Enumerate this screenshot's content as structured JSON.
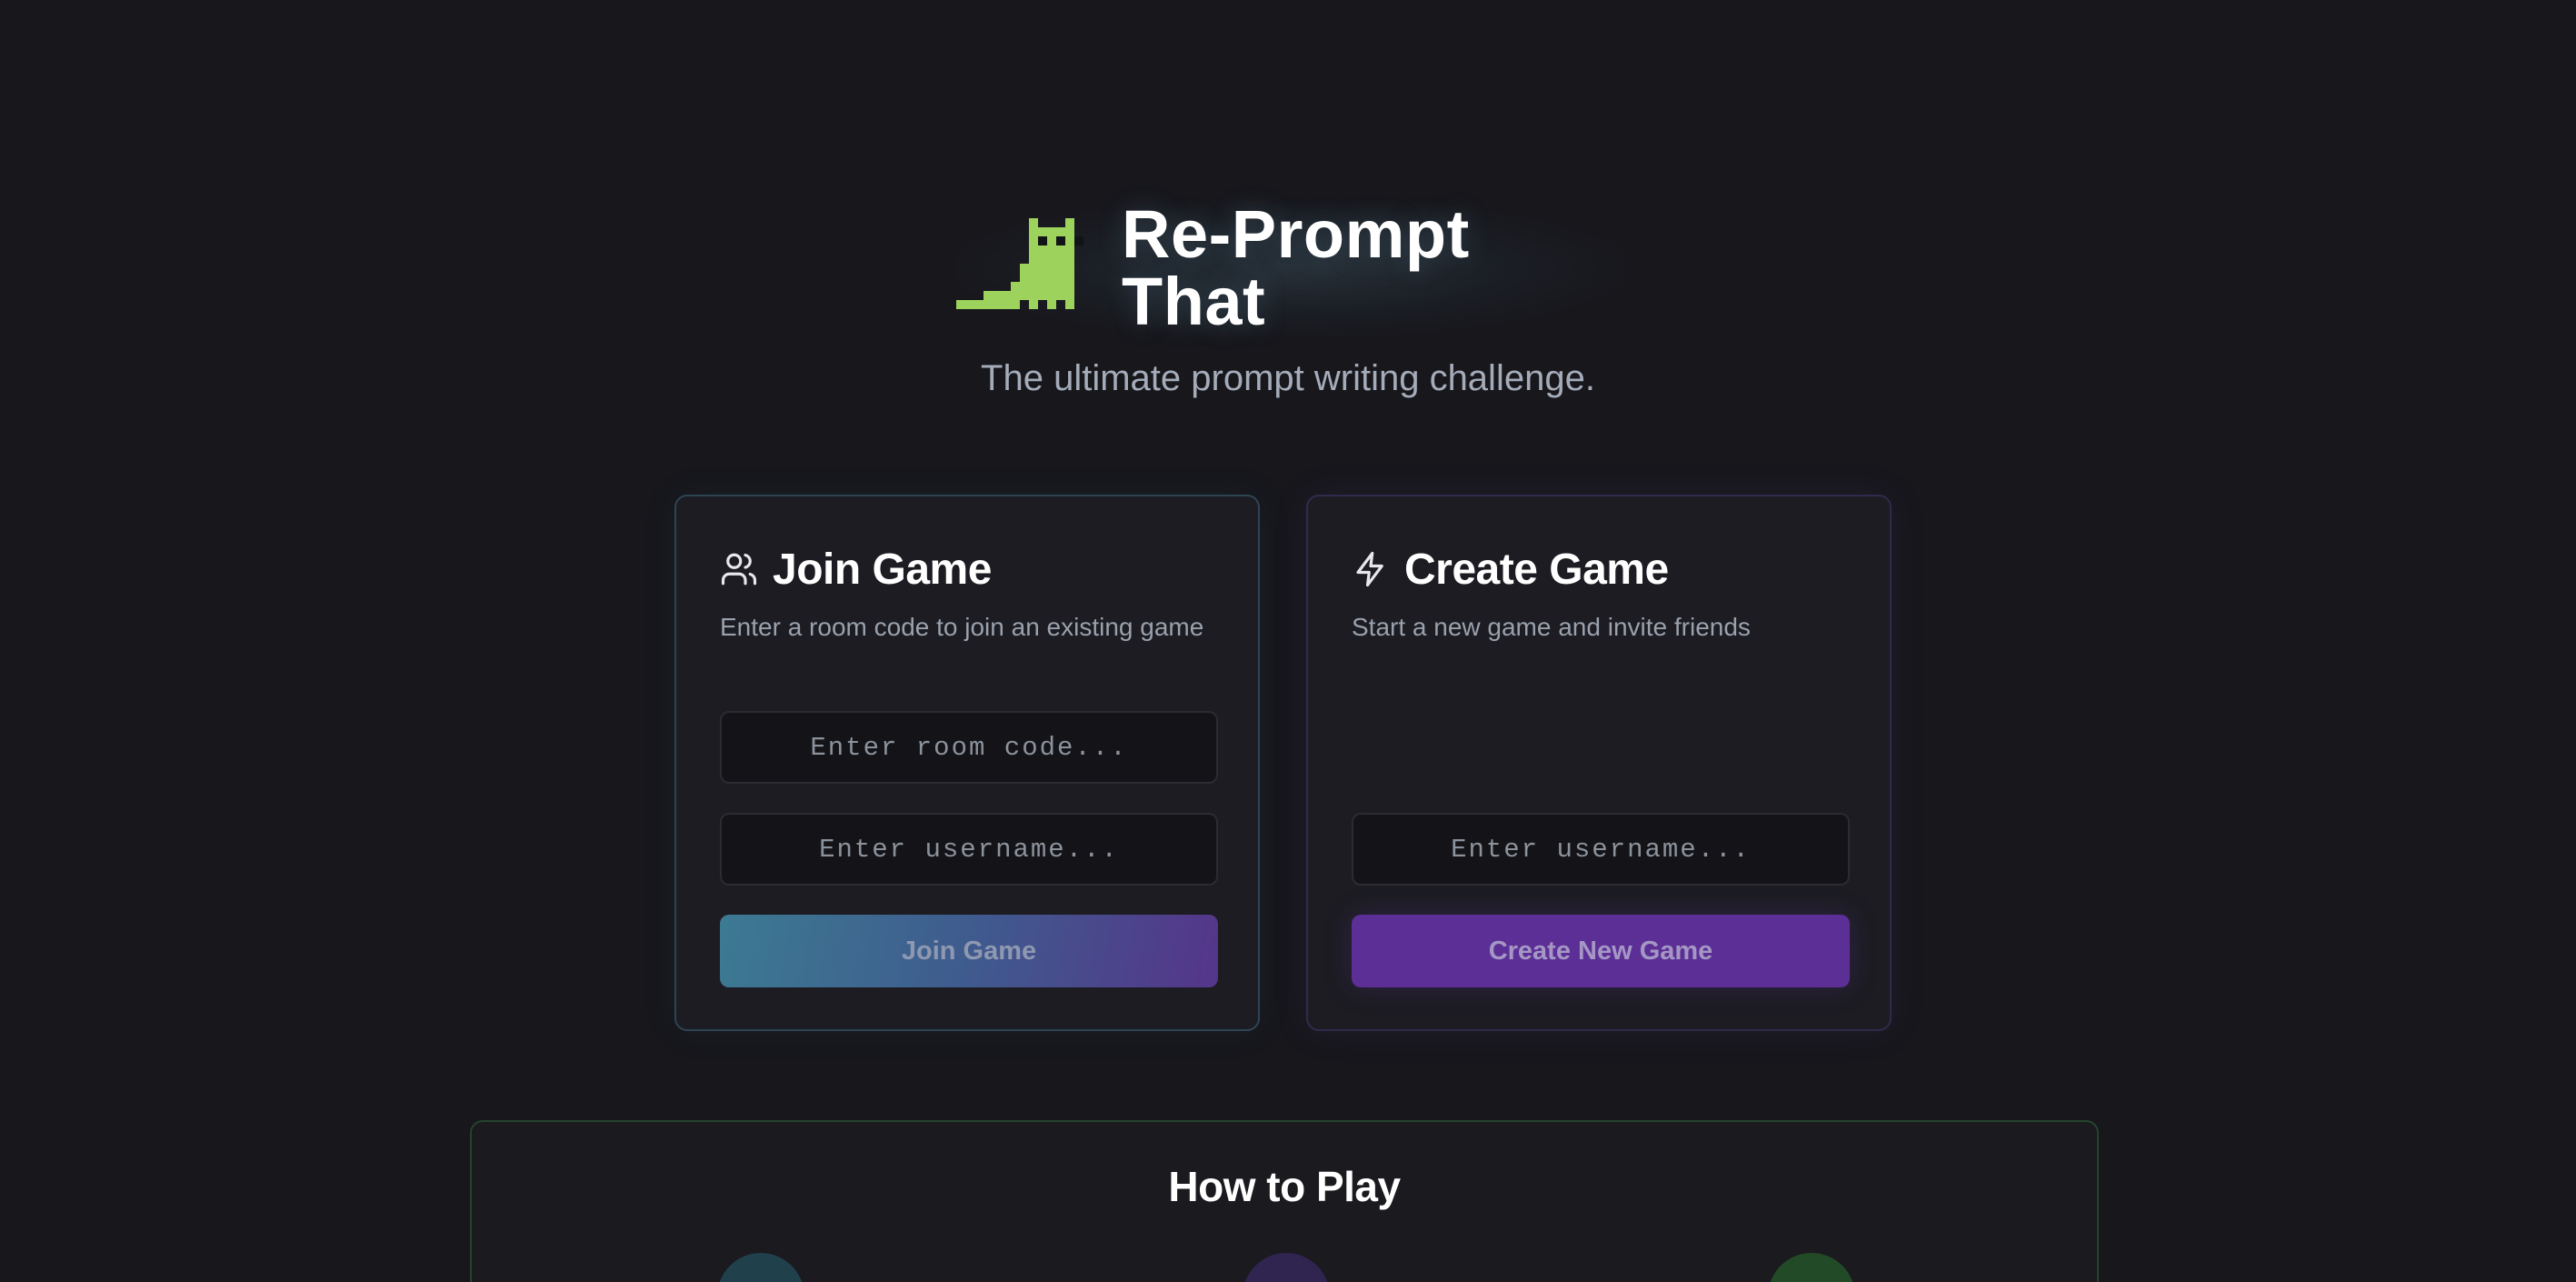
{
  "header": {
    "title": "Re-Prompt That",
    "tagline": "The ultimate prompt writing challenge.",
    "logo_icon": "pixel-cat-icon"
  },
  "join_card": {
    "icon": "users-icon",
    "title": "Join Game",
    "description": "Enter a room code to join an existing game",
    "room_code_placeholder": "Enter room code...",
    "room_code_value": "",
    "username_placeholder": "Enter username...",
    "username_value": "",
    "button_label": "Join Game"
  },
  "create_card": {
    "icon": "lightning-icon",
    "title": "Create Game",
    "description": "Start a new game and invite friends",
    "username_placeholder": "Enter username...",
    "username_value": "",
    "button_label": "Create New Game"
  },
  "how_to_play": {
    "title": "How to Play"
  },
  "colors": {
    "background": "#17171c",
    "logo_green": "#9dd25c",
    "join_accent": "#3c7a92",
    "create_accent": "#5c2f97",
    "howto_border": "#26432c"
  }
}
